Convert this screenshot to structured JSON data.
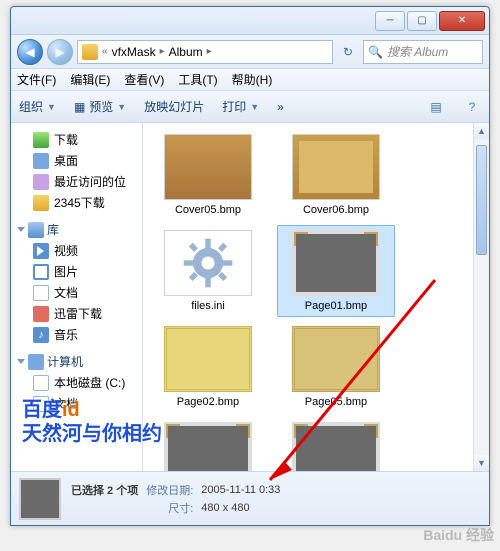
{
  "titlebar": {
    "min": "—",
    "max": "□",
    "close": "X"
  },
  "address": {
    "seg1": "vfxMask",
    "seg2": "Album",
    "search_placeholder": "搜索 Album"
  },
  "menu": {
    "file": "文件(F)",
    "edit": "编辑(E)",
    "view": "查看(V)",
    "tools": "工具(T)",
    "help": "帮助(H)"
  },
  "toolbar": {
    "organize": "组织",
    "preview": "预览",
    "slideshow": "放映幻灯片",
    "print": "打印"
  },
  "nav": {
    "downloads": "下载",
    "desktop": "桌面",
    "recent": "最近访问的位",
    "folder2345": "2345下载",
    "libraries": "库",
    "videos": "视频",
    "pictures": "图片",
    "documents": "文档",
    "xunlei": "迅雷下载",
    "music": "音乐",
    "computer": "计算机",
    "localdisk": "本地磁盘 (C:)",
    "documents2": "文档"
  },
  "files": {
    "cover05": "Cover05.bmp",
    "cover06": "Cover06.bmp",
    "filesini": "files.ini",
    "page01": "Page01.bmp",
    "page02": "Page02.bmp",
    "page05": "Page05.bmp"
  },
  "details": {
    "summary": "已选择 2 个项",
    "mod_label": "修改日期:",
    "mod_value": "2005-11-11 0:33",
    "size_label": "尺寸:",
    "size_value": "480 x 480"
  },
  "overlay": {
    "line1a": "百度",
    "line1b": "id",
    "line2": "天然河与你相约"
  },
  "watermark": "Baidu 经验"
}
